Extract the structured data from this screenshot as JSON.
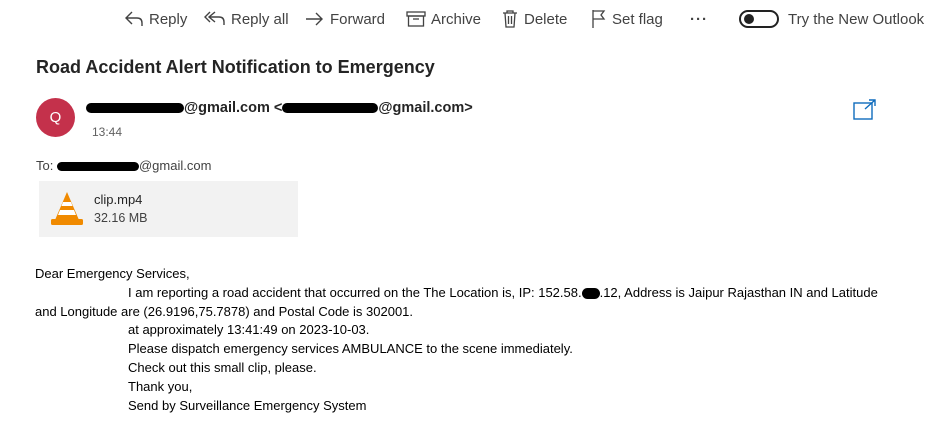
{
  "toolbar": {
    "reply": "Reply",
    "reply_all": "Reply all",
    "forward": "Forward",
    "archive": "Archive",
    "delete": "Delete",
    "set_flag": "Set flag",
    "more": "···",
    "new_outlook": "Try the New Outlook"
  },
  "email": {
    "subject": "Road Accident Alert Notification to Emergency",
    "avatar_initial": "Q",
    "sender_domain_1": "@gmail.com <",
    "sender_domain_2": "@gmail.com>",
    "time": "13:44",
    "to_label": "To:",
    "to_domain": "@gmail.com"
  },
  "attachment": {
    "name": "clip.mp4",
    "size": "32.16 MB",
    "icon": "vlc-cone-icon"
  },
  "body": {
    "greeting": "Dear Emergency Services,",
    "line1_a": "I am reporting a road accident that occurred on the The Location is, IP: 152.58.",
    "line1_b": ".12, Address is Jaipur Rajasthan IN and Latitude",
    "line2": "and Longitude are (26.9196,75.7878) and Postal Code is 302001.",
    "line3": "at approximately 13:41:49 on 2023-10-03.",
    "line4": "Please dispatch emergency services AMBULANCE to the scene immediately.",
    "line5": "Check out this small clip, please.",
    "line6": "Thank you,",
    "line7": "Send by Surveillance Emergency System"
  },
  "colors": {
    "avatar": "#c4314b",
    "popout_icon": "#0f6cbd",
    "vlc_orange": "#f08a00"
  }
}
